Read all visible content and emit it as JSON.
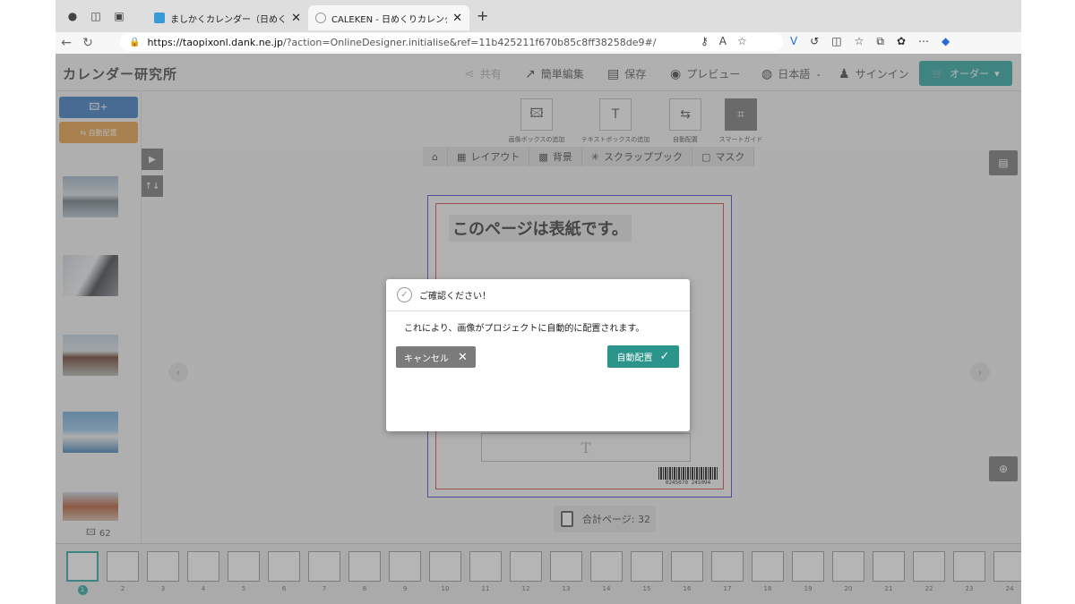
{
  "browser": {
    "tabs": [
      {
        "title": "ましかくカレンダー（日めくり） -",
        "active": false
      },
      {
        "title": "CALEKEN - 日めくりカレンダー",
        "active": true
      }
    ],
    "url_host": "https://taopixonl.dank.ne.jp",
    "url_rest": "/?action=OnlineDesigner.initialise&ref=11b425211f670b85c8ff38258de9#/"
  },
  "app": {
    "logo": "カレンダー研究所",
    "header": {
      "share": "共有",
      "easy_edit": "簡単編集",
      "save": "保存",
      "preview": "プレビュー",
      "language": "日本語",
      "signin": "サインイン",
      "order": "オーダー"
    },
    "tools": [
      {
        "label": "画像ボックスの追加",
        "icon": "image-box-icon"
      },
      {
        "label": "テキストボックスの追加",
        "icon": "text-box-icon"
      },
      {
        "label": "自動配置",
        "icon": "auto-place-icon"
      },
      {
        "label": "スマートガイド",
        "icon": "smart-guide-icon"
      }
    ],
    "subtabs": [
      {
        "label": "レイアウト"
      },
      {
        "label": "背景"
      },
      {
        "label": "スクラップブック"
      },
      {
        "label": "マスク"
      }
    ],
    "sidebar": {
      "auto_label": "自動配置",
      "photo_count": "62"
    },
    "canvas": {
      "cover_title": "このページは表紙です。",
      "text_placeholder": "T",
      "barcode_number": "0245070 245094",
      "total_pages_label": "合計ページ:",
      "total_pages_value": "32"
    },
    "page_numbers": [
      "1",
      "2",
      "3",
      "4",
      "5",
      "6",
      "7",
      "8",
      "9",
      "10",
      "11",
      "12",
      "13",
      "14",
      "15",
      "16",
      "17",
      "18",
      "19",
      "20",
      "21",
      "22",
      "23",
      "24"
    ]
  },
  "modal": {
    "title": "ご確認ください！",
    "message": "これにより、画像がプロジェクトに自動的に配置されます。",
    "cancel": "キャンセル",
    "confirm": "自動配置"
  },
  "colors": {
    "accent": "#2aa7a0",
    "confirm": "#2b958c",
    "add_image": "#3a78c3",
    "auto_place": "#e8a145",
    "cancel": "#7b7b7b"
  }
}
